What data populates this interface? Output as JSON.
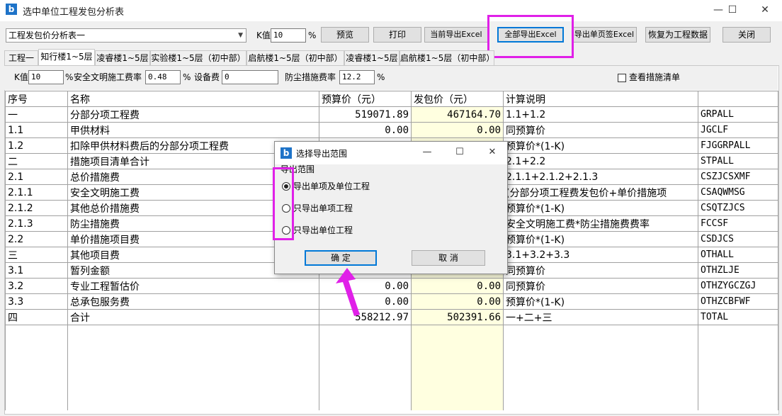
{
  "window": {
    "title": "选中单位工程发包分析表",
    "minimize_glyph": "—",
    "maximize_glyph": "☐",
    "close_glyph": "✕",
    "app_icon_glyph": "b"
  },
  "toolbar": {
    "report_select": "工程发包价分析表一",
    "k_label": "K值",
    "k_value": "10",
    "percent": "%",
    "buttons": {
      "preview": "预览",
      "print": "打印",
      "export_current": "当前导出Excel",
      "export_all": "全部导出Excel",
      "export_single_page": "导出单页签Excel",
      "restore": "恢复为工程数据",
      "close": "关闭"
    }
  },
  "tabs": [
    "工程一",
    "知行楼1~5层",
    "凌睿楼1~5层",
    "实验楼1~5层（初中部）",
    "启航楼1~5层（初中部）",
    "凌睿楼1~5层",
    "启航楼1~5层（初中部）"
  ],
  "params": {
    "k_label": "K值",
    "k_value": "10",
    "percent": "%",
    "safety_rate_label": "安全文明施工费率",
    "safety_rate_value": "0.48",
    "equipment_label": "设备费",
    "equipment_value": "0",
    "dust_rate_label": "防尘措施费率",
    "dust_rate_value": "12.2",
    "view_measures_label": "查看措施清单"
  },
  "table": {
    "headers": [
      "序号",
      "名称",
      "预算价（元）",
      "发包价（元）",
      "计算说明",
      ""
    ],
    "rows": [
      [
        "一",
        "分部分项工程费",
        "519071.89",
        "467164.70",
        "1.1+1.2",
        "GRPALL"
      ],
      [
        "1.1",
        "甲供材料",
        "0.00",
        "0.00",
        "同预算价",
        "JGCLF"
      ],
      [
        "1.2",
        "扣除甲供材料费后的分部分项工程费",
        "",
        "",
        "预算价*(1-K)",
        "FJGGRPALL"
      ],
      [
        "二",
        "措施项目清单合计",
        "",
        "",
        "2.1+2.2",
        "STPALL"
      ],
      [
        "2.1",
        "总价措施费",
        "",
        "",
        "2.1.1+2.1.2+2.1.3",
        "CSZJCSXMF"
      ],
      [
        "2.1.1",
        "安全文明施工费",
        "",
        "",
        "(分部分项工程费发包价+单价措施项",
        "CSAQWMSG"
      ],
      [
        "2.1.2",
        "其他总价措施费",
        "",
        "",
        "预算价*(1-K)",
        "CSQTZJCS"
      ],
      [
        "2.1.3",
        "防尘措施费",
        "",
        "",
        "安全文明施工费*防尘措施费费率",
        "FCCSF"
      ],
      [
        "2.2",
        "单价措施项目费",
        "",
        "",
        "预算价*(1-K)",
        "CSDJCS"
      ],
      [
        "三",
        "其他项目费",
        "",
        "",
        "3.1+3.2+3.3",
        "OTHALL"
      ],
      [
        "3.1",
        "暂列金额",
        "",
        "",
        "同预算价",
        "OTHZLJE"
      ],
      [
        "3.2",
        "专业工程暂估价",
        "0.00",
        "0.00",
        "同预算价",
        "OTHZYGCZGJ"
      ],
      [
        "3.3",
        "总承包服务费",
        "0.00",
        "0.00",
        "预算价*(1-K)",
        "OTHZCBFWF"
      ],
      [
        "四",
        "合计",
        "558212.97",
        "502391.66",
        "一+二+三",
        "TOTAL"
      ]
    ]
  },
  "dialog": {
    "title": "选择导出范围",
    "group_label": "导出范围",
    "options": [
      "导出单项及单位工程",
      "只导出单项工程",
      "只导出单位工程"
    ],
    "selected_index": 0,
    "ok": "确 定",
    "cancel": "取 消"
  },
  "colors": {
    "highlight": "#e020e8",
    "yellow_cell": "#ffffe0",
    "accent": "#0078d7"
  }
}
